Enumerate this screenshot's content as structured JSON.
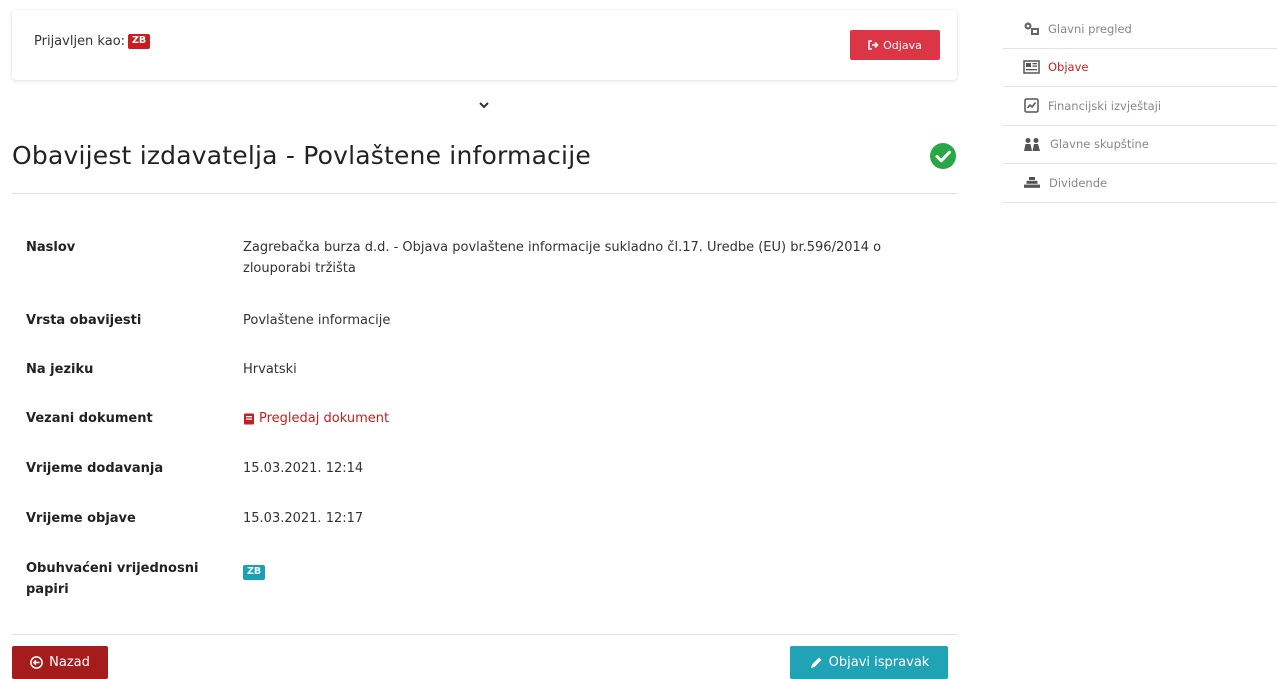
{
  "header": {
    "logged_in_label": "Prijavljen kao:",
    "user_badge": "ZB",
    "logout_label": "Odjava"
  },
  "page": {
    "title": "Obavijest izdavatelja - Povlaštene informacije",
    "status": "published",
    "status_color": "#28a745"
  },
  "details": {
    "rows": [
      {
        "label": "Naslov",
        "value": "Zagrebačka burza d.d. - Objava povlaštene informacije sukladno čl.17. Uredbe (EU) br.596/2014 o zlouporabi tržišta"
      },
      {
        "label": "Vrsta obavijesti",
        "value": "Povlaštene informacije"
      },
      {
        "label": "Na jeziku",
        "value": "Hrvatski"
      },
      {
        "label": "Vezani dokument",
        "value": "Pregledaj dokument"
      },
      {
        "label": "Vrijeme dodavanja",
        "value": "15.03.2021. 12:14"
      },
      {
        "label": "Vrijeme objave",
        "value": "15.03.2021. 12:17"
      },
      {
        "label": "Obuhvaćeni vrijednosni papiri",
        "value": "ZB"
      }
    ]
  },
  "actions": {
    "back_label": "Nazad",
    "publish_fix_label": "Objavi ispravak"
  },
  "sidebar": {
    "items": [
      {
        "label": "Glavni pregled",
        "icon": "dashboard-icon",
        "active": false
      },
      {
        "label": "Objave",
        "icon": "newspaper-icon",
        "active": true
      },
      {
        "label": "Financijski izvještaji",
        "icon": "chart-icon",
        "active": false
      },
      {
        "label": "Glavne skupštine",
        "icon": "people-icon",
        "active": false
      },
      {
        "label": "Dividende",
        "icon": "coins-icon",
        "active": false
      }
    ]
  },
  "colors": {
    "brand_red": "#c81e1e",
    "logout_red": "#dc3545",
    "teal": "#1fa3b5"
  }
}
